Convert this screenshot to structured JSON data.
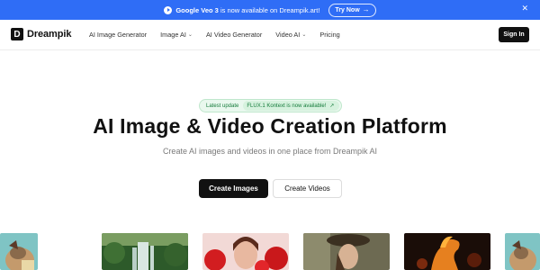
{
  "promo": {
    "product": "Google Veo 3",
    "message": " is now available on Dreampik.art!",
    "cta": "Try Now",
    "bg_color": "#2f6df6"
  },
  "nav": {
    "logo_letter": "D",
    "brand": "Dreampik",
    "menu": [
      {
        "label": "AI Image Generator",
        "dropdown": false
      },
      {
        "label": "Image AI",
        "dropdown": true
      },
      {
        "label": "AI Video Generator",
        "dropdown": false
      },
      {
        "label": "Video AI",
        "dropdown": true
      },
      {
        "label": "Pricing",
        "dropdown": false
      }
    ],
    "signin": "Sign In"
  },
  "hero": {
    "badge_label": "Latest update",
    "badge_message": "FLUX.1 Kontext is now available!",
    "title": "AI Image & Video Creation Platform",
    "subtitle": "Create AI images and videos in one place from Dreampik AI",
    "primary_cta": "Create Images",
    "secondary_cta": "Create Videos"
  },
  "gallery": {
    "items": [
      {
        "name": "armadillo-illustration"
      },
      {
        "name": "waterfall-forest"
      },
      {
        "name": "portrait-red-roses"
      },
      {
        "name": "portrait-woman-hat"
      },
      {
        "name": "fire-horse"
      },
      {
        "name": "armadillo-illustration"
      }
    ]
  }
}
